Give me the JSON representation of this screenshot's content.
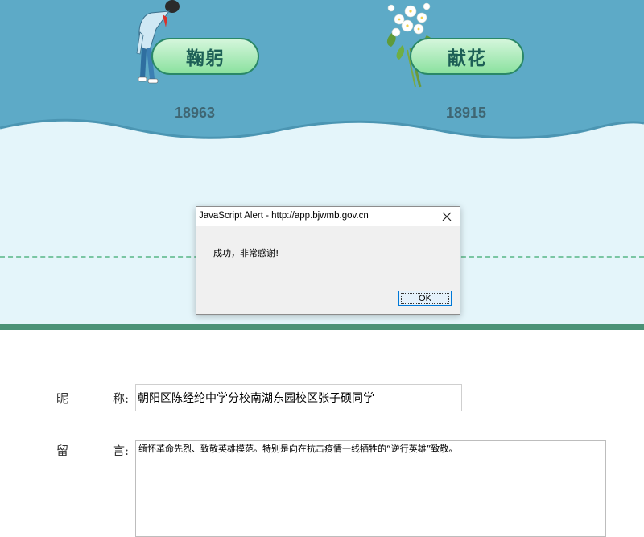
{
  "banner": {
    "bow": {
      "label": "鞠躬",
      "count": "18963",
      "icon": "bowing-student-icon"
    },
    "flower": {
      "label": "献花",
      "count": "18915",
      "icon": "flower-bouquet-icon"
    }
  },
  "alert": {
    "title": "JavaScript Alert - http://app.bjwmb.gov.cn",
    "message": "成功，非常感谢!",
    "ok_label": "OK",
    "close_icon": "close-icon"
  },
  "form": {
    "nickname_label_a": "昵",
    "nickname_label_b": "称:",
    "nickname_value": "朝阳区陈经纶中学分校南湖东园校区张子硕同学",
    "message_label_a": "留",
    "message_label_b": "言:",
    "message_value": "缅怀革命先烈、致敬英雄模范。特别是向在抗击疫情一线牺牲的“逆行英雄”致敬。"
  },
  "colors": {
    "banner_blue": "#5daac7",
    "light_zone": "#e4f5fa",
    "pill_border": "#2a8867",
    "pill_text": "#1d5f56",
    "count_text": "#3f6673",
    "divider_green": "#4b9276",
    "dashed_green": "#7ac6a3"
  }
}
